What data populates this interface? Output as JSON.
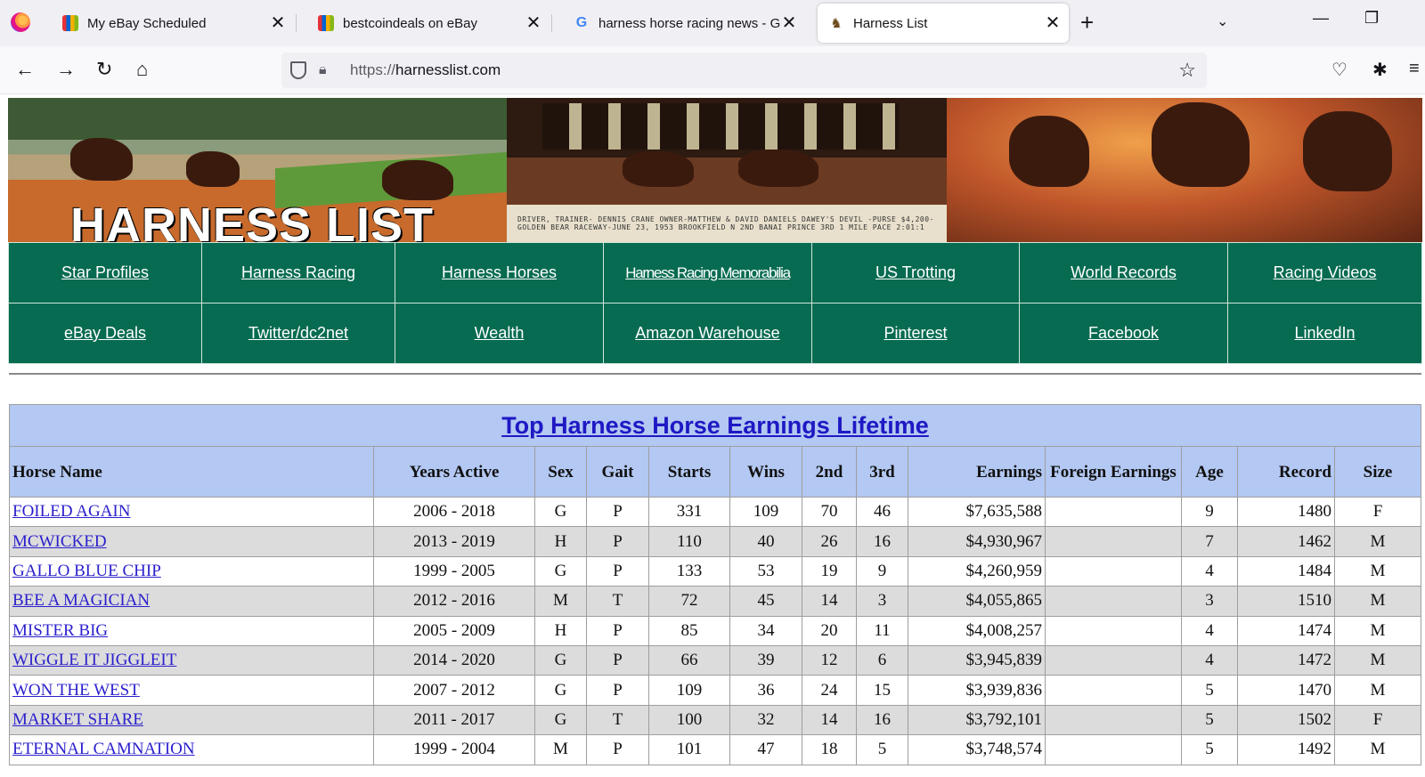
{
  "browser": {
    "tabs": [
      {
        "title": "My eBay Scheduled",
        "favicon": "ebay-bag-icon"
      },
      {
        "title": "bestcoindeals on eBay",
        "favicon": "ebay-bag-icon"
      },
      {
        "title": "harness horse racing news - Go",
        "favicon": "google-g-icon"
      },
      {
        "title": "Harness List",
        "favicon": "horse-icon",
        "active": true
      }
    ],
    "close_glyph": "✕",
    "new_tab_glyph": "+",
    "url": {
      "scheme": "https://",
      "host": "harnesslist.com"
    }
  },
  "banner": {
    "title": "HARNESS LIST",
    "photo_caption": "DRIVER, TRAINER- DENNIS CRANE  OWNER-MATTHEW & DAVID DANIELS   DAWEY'S DEVIL  -PURSE $4,200-  GOLDEN BEAR RACEWAY-JUNE 23, 1953  BROOKFIELD N 2ND  BANAI PRINCE 3RD  1 MILE PACE 2:01:1"
  },
  "menu": {
    "row1": [
      "Star Profiles",
      "Harness Racing",
      "Harness Horses",
      "Harness Racing Memorabilia",
      "US Trotting",
      "World Records",
      "Racing Videos"
    ],
    "row2": [
      "eBay Deals",
      "Twitter/dc2net",
      "Wealth",
      "Amazon Warehouse",
      "Pinterest",
      "Facebook",
      "LinkedIn"
    ]
  },
  "table": {
    "title": "Top Harness Horse Earnings Lifetime",
    "headers": [
      "Horse Name",
      "Years Active",
      "Sex",
      "Gait",
      "Starts",
      "Wins",
      "2nd",
      "3rd",
      "Earnings",
      "Foreign Earnings",
      "Age",
      "Record",
      "Size"
    ],
    "rows": [
      {
        "name": "FOILED AGAIN",
        "years": "2006 - 2018",
        "sex": "G",
        "gait": "P",
        "starts": "331",
        "wins": "109",
        "second": "70",
        "third": "46",
        "earnings": "$7,635,588",
        "foreign": "",
        "age": "9",
        "record": "1480",
        "size": "F"
      },
      {
        "name": "MCWICKED",
        "years": "2013 - 2019",
        "sex": "H",
        "gait": "P",
        "starts": "110",
        "wins": "40",
        "second": "26",
        "third": "16",
        "earnings": "$4,930,967",
        "foreign": "",
        "age": "7",
        "record": "1462",
        "size": "M"
      },
      {
        "name": "GALLO BLUE CHIP",
        "years": "1999 - 2005",
        "sex": "G",
        "gait": "P",
        "starts": "133",
        "wins": "53",
        "second": "19",
        "third": "9",
        "earnings": "$4,260,959",
        "foreign": "",
        "age": "4",
        "record": "1484",
        "size": "M"
      },
      {
        "name": "BEE A MAGICIAN",
        "years": "2012 - 2016",
        "sex": "M",
        "gait": "T",
        "starts": "72",
        "wins": "45",
        "second": "14",
        "third": "3",
        "earnings": "$4,055,865",
        "foreign": "",
        "age": "3",
        "record": "1510",
        "size": "M"
      },
      {
        "name": "MISTER BIG",
        "years": "2005 - 2009",
        "sex": "H",
        "gait": "P",
        "starts": "85",
        "wins": "34",
        "second": "20",
        "third": "11",
        "earnings": "$4,008,257",
        "foreign": "",
        "age": "4",
        "record": "1474",
        "size": "M"
      },
      {
        "name": "WIGGLE IT JIGGLEIT",
        "years": "2014 - 2020",
        "sex": "G",
        "gait": "P",
        "starts": "66",
        "wins": "39",
        "second": "12",
        "third": "6",
        "earnings": "$3,945,839",
        "foreign": "",
        "age": "4",
        "record": "1472",
        "size": "M"
      },
      {
        "name": "WON THE WEST",
        "years": "2007 - 2012",
        "sex": "G",
        "gait": "P",
        "starts": "109",
        "wins": "36",
        "second": "24",
        "third": "15",
        "earnings": "$3,939,836",
        "foreign": "",
        "age": "5",
        "record": "1470",
        "size": "M"
      },
      {
        "name": "MARKET SHARE",
        "years": "2011 - 2017",
        "sex": "G",
        "gait": "T",
        "starts": "100",
        "wins": "32",
        "second": "14",
        "third": "16",
        "earnings": "$3,792,101",
        "foreign": "",
        "age": "5",
        "record": "1502",
        "size": "F"
      },
      {
        "name": "ETERNAL CAMNATION",
        "years": "1999 - 2004",
        "sex": "M",
        "gait": "P",
        "starts": "101",
        "wins": "47",
        "second": "18",
        "third": "5",
        "earnings": "$3,748,574",
        "foreign": "",
        "age": "5",
        "record": "1492",
        "size": "M"
      }
    ]
  },
  "colors": {
    "menu_bg": "#076b51",
    "table_header_bg": "#b3c8f2",
    "link": "#2a1fcc",
    "row_alt": "#dcdcdc"
  }
}
